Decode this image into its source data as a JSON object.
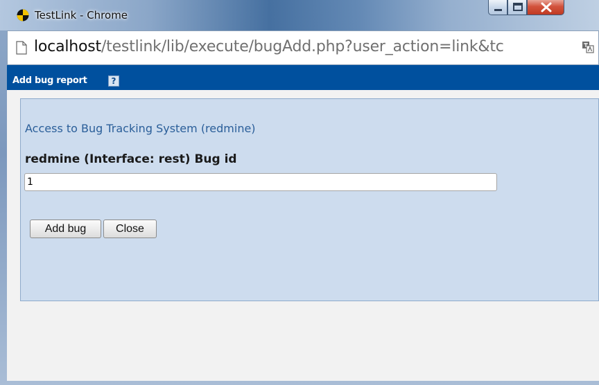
{
  "window": {
    "title": "TestLink - Chrome"
  },
  "address_bar": {
    "host": "localhost",
    "path": "/testlink/lib/execute/bugAdd.php?user_action=link&tc"
  },
  "header": {
    "title": "Add bug report",
    "help_glyph": "?"
  },
  "panel": {
    "access_text": "Access to Bug Tracking System (redmine)",
    "field_label": "redmine (Interface: rest) Bug id",
    "bug_id_value": "1"
  },
  "buttons": {
    "add_label": "Add bug",
    "close_label": "Close"
  },
  "colors": {
    "header_bg": "#00509e",
    "panel_bg": "#cddcee",
    "link_text": "#2a5e99"
  }
}
